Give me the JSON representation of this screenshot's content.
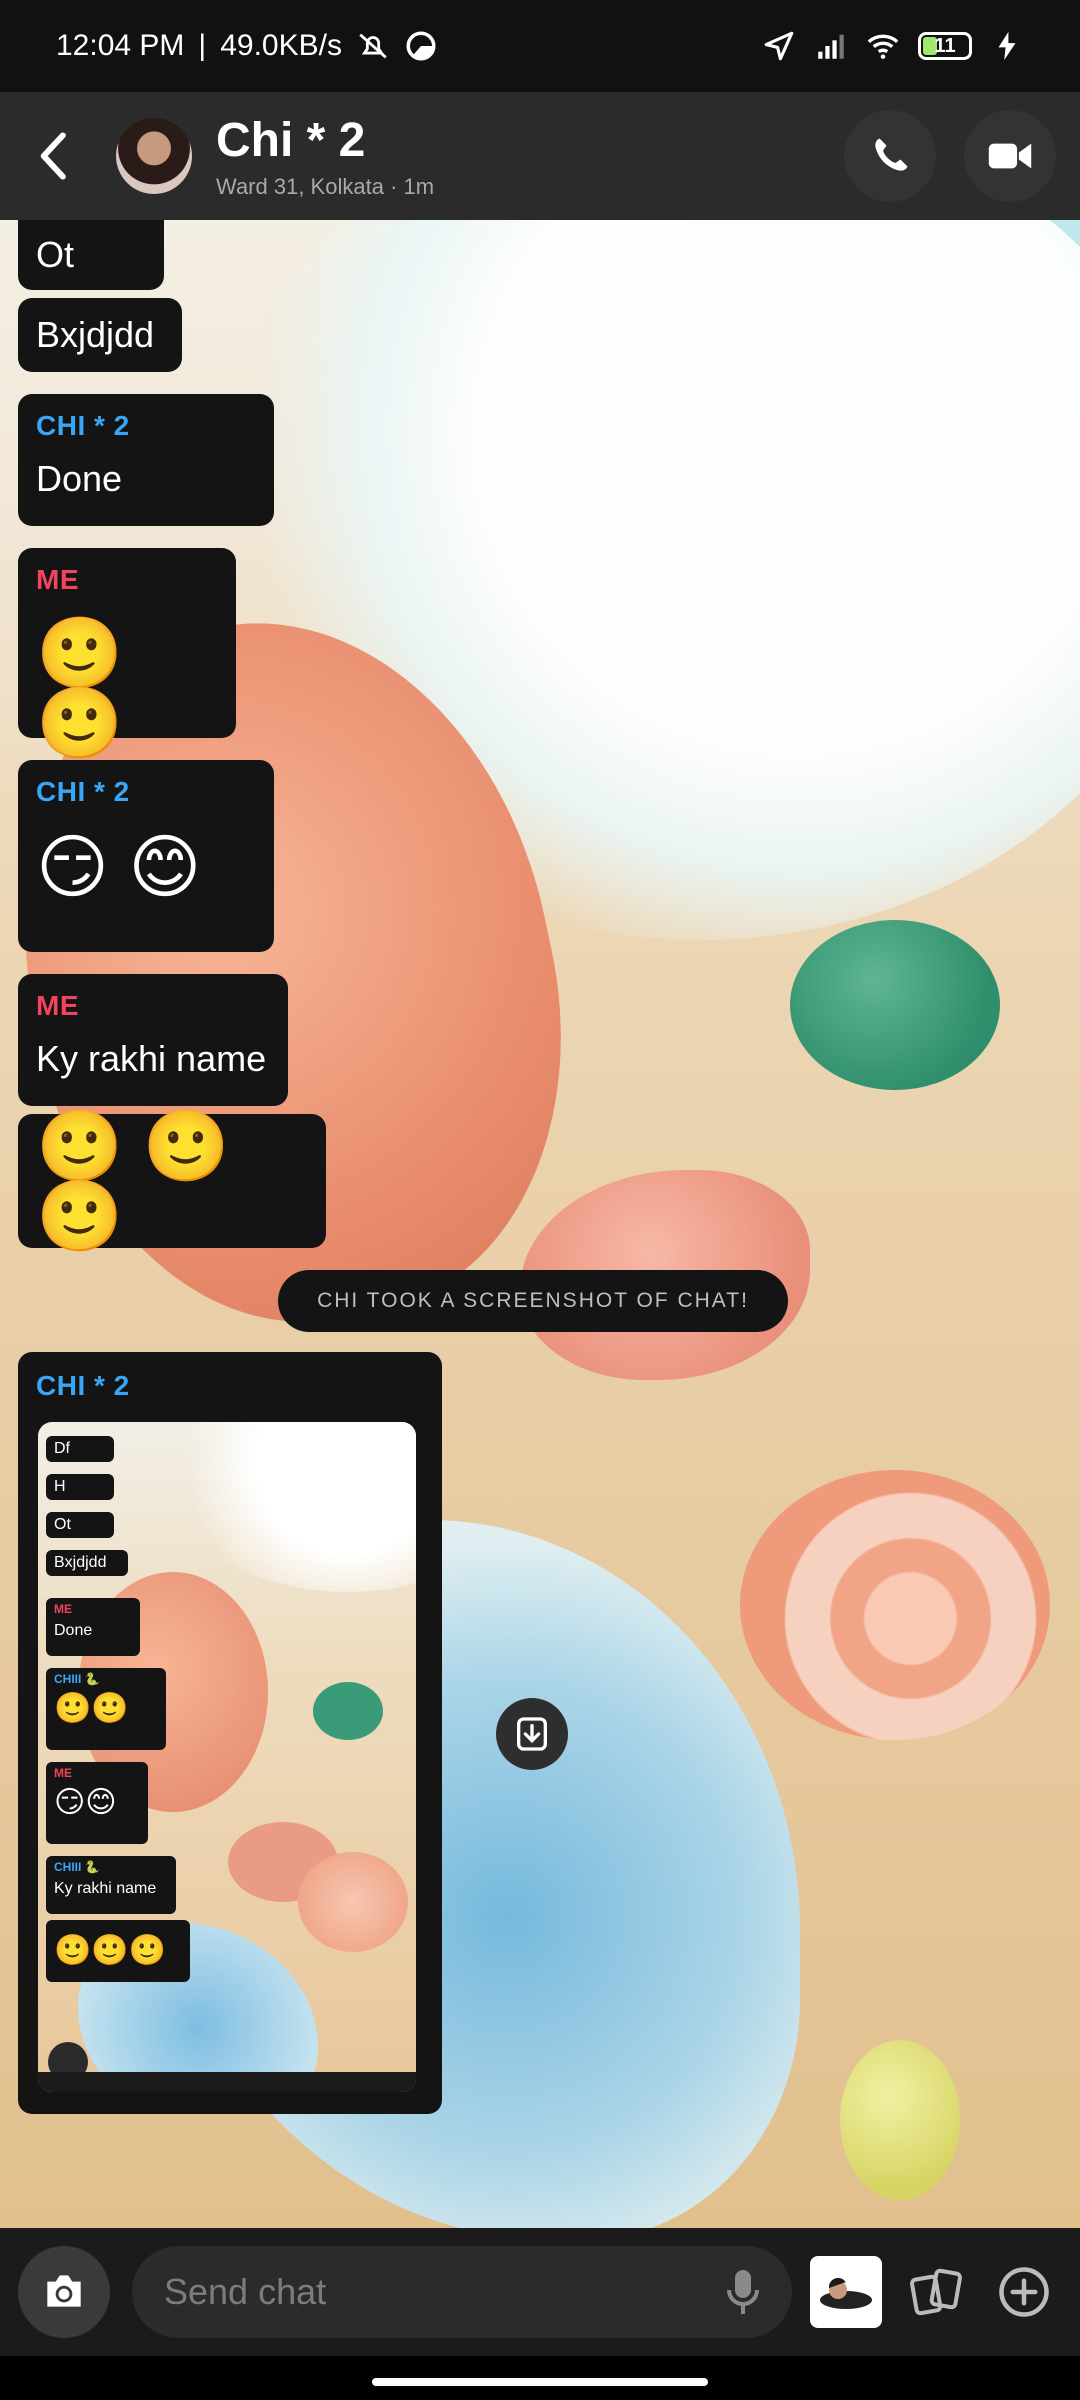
{
  "status_bar": {
    "time": "12:04 PM",
    "speed": "49.0KB/s",
    "battery": "11"
  },
  "header": {
    "title": "Chi * 2",
    "location": "Ward 31, Kolkata",
    "time_ago": "1m"
  },
  "messages": [
    {
      "text": "Ot"
    },
    {
      "text": "Bxjdjdd"
    },
    {
      "sender": "CHI * 2",
      "text": "Done"
    },
    {
      "sender": "ME",
      "emoji": "🙂 🙂"
    },
    {
      "sender": "CHI * 2",
      "emoji": "😏 😊"
    },
    {
      "sender": "ME",
      "text": "Ky rakhi name"
    },
    {
      "emoji": "🙂 🙂 🙂"
    }
  ],
  "system_message": "CHI TOOK A SCREENSHOT OF CHAT!",
  "snap": {
    "sender": "CHI * 2",
    "preview": {
      "items": [
        "Df",
        "H",
        "Ot",
        "Bxjdjdd"
      ],
      "me_label": "ME",
      "me_text": "Done",
      "them_label": "CHIII 🐍",
      "them_emoji": "🙂🙂",
      "me_label_2": "ME",
      "me_emoji": "😏😊",
      "them_label_2": "CHIII 🐍",
      "them_text": "Ky rakhi name",
      "last_emoji": "🙂🙂🙂"
    }
  },
  "input": {
    "placeholder": "Send chat"
  },
  "colors": {
    "them": "#3ba6f5",
    "me": "#f0455c",
    "bubble": "#141414"
  },
  "icons": [
    "back-icon",
    "phone-icon",
    "video-icon",
    "camera-icon",
    "mic-icon",
    "cards-icon",
    "plus-icon",
    "save-icon"
  ]
}
